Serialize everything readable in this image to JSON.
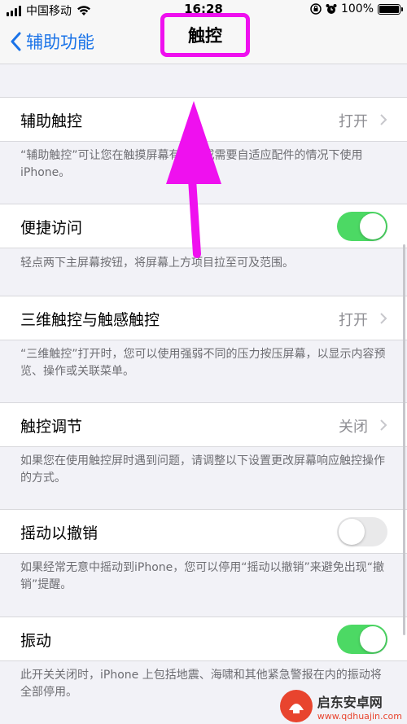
{
  "status_bar": {
    "carrier": "中国移动",
    "time": "16:28",
    "battery_percent": "100%",
    "battery_level": 1.0
  },
  "nav": {
    "back_label": "辅助功能",
    "title": "触控"
  },
  "settings": [
    {
      "label": "辅助触控",
      "value": "打开",
      "note": "“辅助触控”可让您在触摸屏幕有困难或需要自适应配件的情况下使用 iPhone。"
    },
    {
      "label": "便捷访问",
      "toggle": true,
      "note": "轻点两下主屏幕按钮，将屏幕上方项目拉至可及范围。"
    },
    {
      "label": "三维触控与触感触控",
      "value": "打开",
      "note": "“三维触控”打开时，您可以使用强弱不同的压力按压屏幕，以显示内容预览、操作或关联菜单。"
    },
    {
      "label": "触控调节",
      "value": "关闭",
      "note": "如果您在使用触控屏时遇到问题，请调整以下设置更改屏幕响应触控操作的方式。"
    },
    {
      "label": "摇动以撤销",
      "toggle": false,
      "note": "如果经常无意中摇动到iPhone，您可以停用“摇动以撤销”来避免出现“撤销”提醒。"
    },
    {
      "label": "振动",
      "toggle": true,
      "note": "此开关关闭时，iPhone 上包括地震、海啸和其他紧急警报在内的振动将全部停用。"
    }
  ],
  "colors": {
    "accent": "#1a73e8",
    "toggle_on": "#4cd964",
    "annotation": "#ef10ef"
  },
  "watermark": {
    "name": "启东安卓网",
    "url": "www.qdhuajin.com"
  }
}
